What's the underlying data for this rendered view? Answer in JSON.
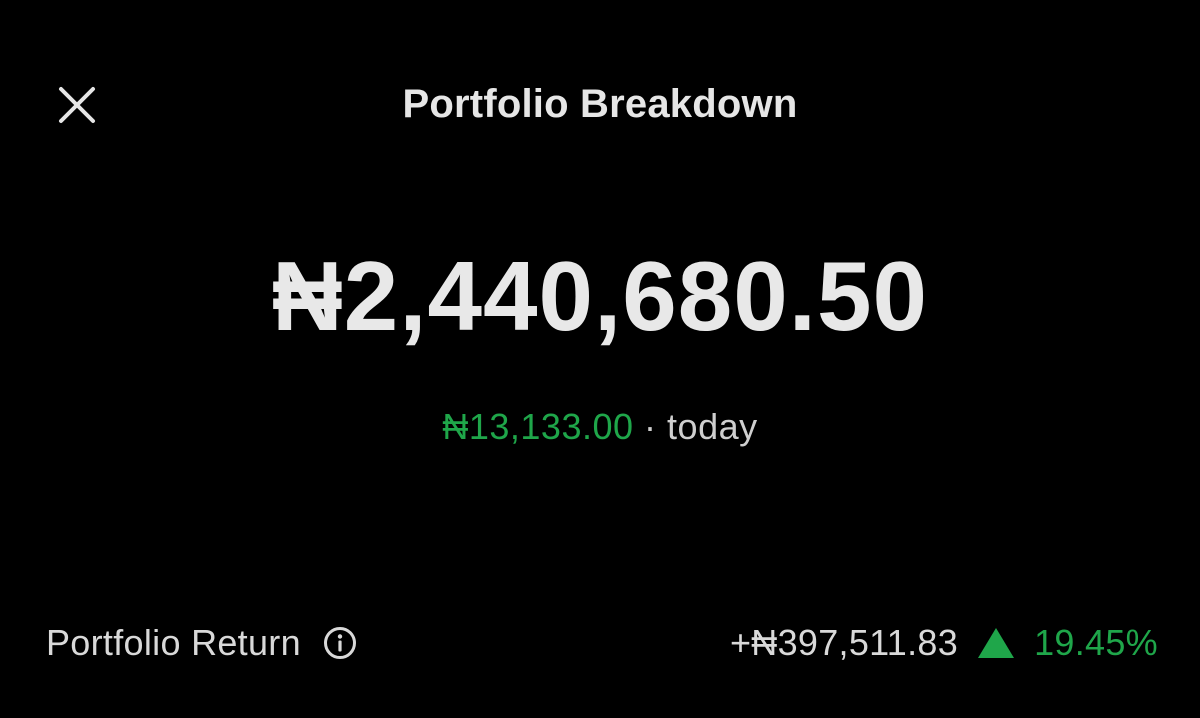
{
  "header": {
    "title": "Portfolio Breakdown",
    "close_icon": "close-icon"
  },
  "balance": {
    "amount": "₦2,440,680.50"
  },
  "daily_change": {
    "amount": "₦13,133.00",
    "separator": "·",
    "period": "today"
  },
  "portfolio_return": {
    "label": "Portfolio Return",
    "info_icon": "info-icon",
    "amount": "+₦397,511.83",
    "trend_icon": "up-triangle-icon",
    "percent": "19.45%"
  },
  "colors": {
    "background": "#000000",
    "text": "#e6e6e6",
    "positive": "#1fa64a"
  }
}
